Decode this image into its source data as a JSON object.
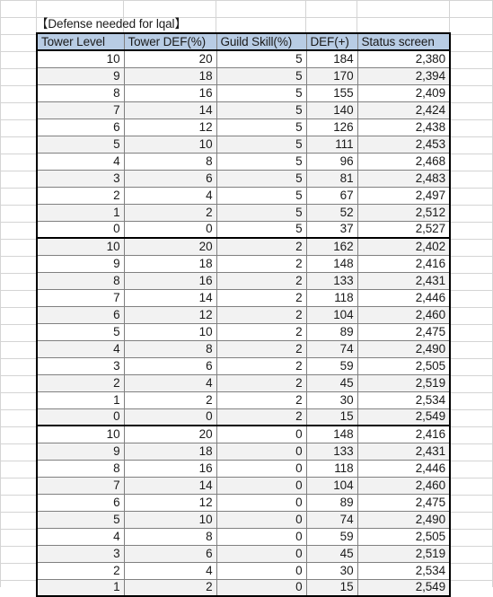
{
  "sheet": {
    "title": "【Defense needed for lqal】",
    "header_fill": "#b8cce4",
    "alt_row_fill": "#f2f2f2",
    "grid_line_color": "#d4d4d4",
    "table_border_color": "#000000"
  },
  "table": {
    "columns": [
      "Tower Level",
      "Tower DEF(%)",
      "Guild Skill(%)",
      "DEF(+)",
      "Status screen"
    ],
    "blocks": [
      {
        "guild_skill": "5",
        "rows": [
          [
            "10",
            "20",
            "5",
            "184",
            "2,380"
          ],
          [
            "9",
            "18",
            "5",
            "170",
            "2,394"
          ],
          [
            "8",
            "16",
            "5",
            "155",
            "2,409"
          ],
          [
            "7",
            "14",
            "5",
            "140",
            "2,424"
          ],
          [
            "6",
            "12",
            "5",
            "126",
            "2,438"
          ],
          [
            "5",
            "10",
            "5",
            "111",
            "2,453"
          ],
          [
            "4",
            "8",
            "5",
            "96",
            "2,468"
          ],
          [
            "3",
            "6",
            "5",
            "81",
            "2,483"
          ],
          [
            "2",
            "4",
            "5",
            "67",
            "2,497"
          ],
          [
            "1",
            "2",
            "5",
            "52",
            "2,512"
          ],
          [
            "0",
            "0",
            "5",
            "37",
            "2,527"
          ]
        ]
      },
      {
        "guild_skill": "2",
        "rows": [
          [
            "10",
            "20",
            "2",
            "162",
            "2,402"
          ],
          [
            "9",
            "18",
            "2",
            "148",
            "2,416"
          ],
          [
            "8",
            "16",
            "2",
            "133",
            "2,431"
          ],
          [
            "7",
            "14",
            "2",
            "118",
            "2,446"
          ],
          [
            "6",
            "12",
            "2",
            "104",
            "2,460"
          ],
          [
            "5",
            "10",
            "2",
            "89",
            "2,475"
          ],
          [
            "4",
            "8",
            "2",
            "74",
            "2,490"
          ],
          [
            "3",
            "6",
            "2",
            "59",
            "2,505"
          ],
          [
            "2",
            "4",
            "2",
            "45",
            "2,519"
          ],
          [
            "1",
            "2",
            "2",
            "30",
            "2,534"
          ],
          [
            "0",
            "0",
            "2",
            "15",
            "2,549"
          ]
        ]
      },
      {
        "guild_skill": "0",
        "rows": [
          [
            "10",
            "20",
            "0",
            "148",
            "2,416"
          ],
          [
            "9",
            "18",
            "0",
            "133",
            "2,431"
          ],
          [
            "8",
            "16",
            "0",
            "118",
            "2,446"
          ],
          [
            "7",
            "14",
            "0",
            "104",
            "2,460"
          ],
          [
            "6",
            "12",
            "0",
            "89",
            "2,475"
          ],
          [
            "5",
            "10",
            "0",
            "74",
            "2,490"
          ],
          [
            "4",
            "8",
            "0",
            "59",
            "2,505"
          ],
          [
            "3",
            "6",
            "0",
            "45",
            "2,519"
          ],
          [
            "2",
            "4",
            "0",
            "30",
            "2,534"
          ],
          [
            "1",
            "2",
            "0",
            "15",
            "2,549"
          ]
        ]
      }
    ]
  },
  "grid": {
    "vlines": [
      0,
      40,
      137,
      240,
      340,
      397,
      500
    ],
    "hline_top": 0,
    "hline_spacing": 19
  }
}
